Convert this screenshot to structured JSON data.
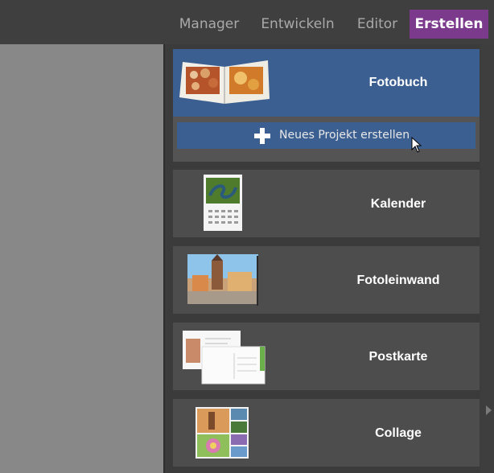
{
  "nav": {
    "tabs": [
      {
        "label": "Manager"
      },
      {
        "label": "Entwickeln"
      },
      {
        "label": "Editor"
      },
      {
        "label": "Erstellen"
      }
    ],
    "active_index": 3
  },
  "cards": [
    {
      "title": "Fotobuch",
      "icon": "photobook-thumbnail"
    },
    {
      "title": "Kalender",
      "icon": "calendar-thumbnail"
    },
    {
      "title": "Fotoleinwand",
      "icon": "canvas-thumbnail"
    },
    {
      "title": "Postkarte",
      "icon": "postcard-thumbnail"
    },
    {
      "title": "Collage",
      "icon": "collage-thumbnail"
    }
  ],
  "new_project": {
    "label": "Neues Projekt erstellen",
    "icon": "plus-icon"
  },
  "colors": {
    "accent_purple": "#7b3a8c",
    "selected_blue": "#3b5f91",
    "card_bg": "#4d4d4d"
  }
}
